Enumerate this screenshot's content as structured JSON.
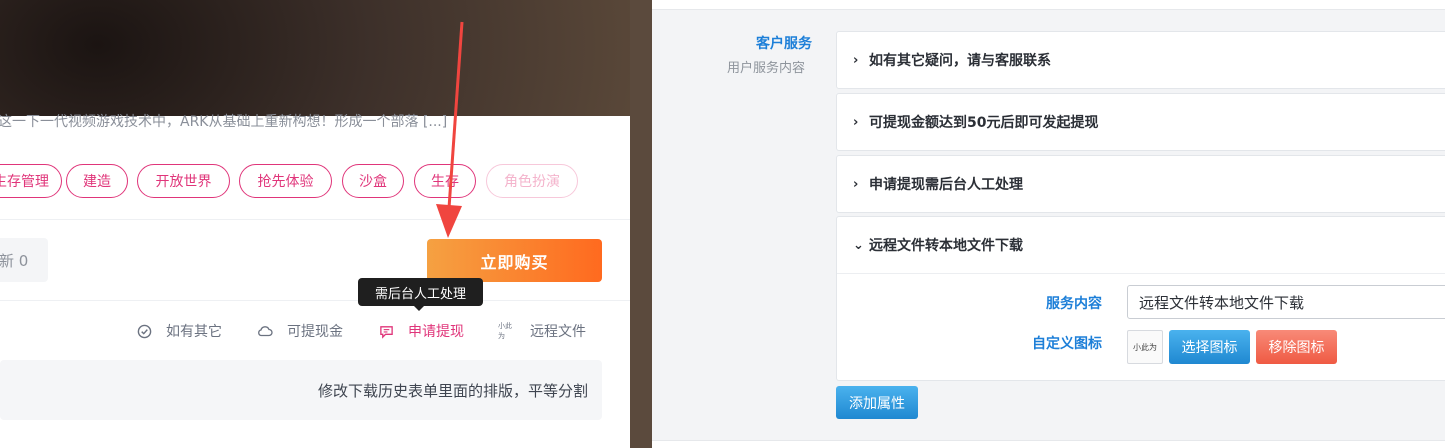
{
  "left": {
    "excerpt": "这一下一代视频游戏技术中，ARK从基础上重新构想！形成一个部落 [...]",
    "tags": [
      {
        "label": "生存管理",
        "faded": false
      },
      {
        "label": "建造",
        "faded": false
      },
      {
        "label": "开放世界",
        "faded": false
      },
      {
        "label": "抢先体验",
        "faded": false
      },
      {
        "label": "沙盒",
        "faded": false
      },
      {
        "label": "生存",
        "faded": false
      },
      {
        "label": "角色扮演",
        "faded": true
      }
    ],
    "update_label": "新 0",
    "buy_button": "立即购买",
    "tooltip": "需后台人工处理",
    "service_tabs": [
      {
        "label": "如有其它",
        "icon": "check-circle-icon"
      },
      {
        "label": "可提现金",
        "icon": "cloud-icon"
      },
      {
        "label": "申请提现",
        "icon": "chat-icon"
      },
      {
        "label": "远程文件",
        "icon": "custom-logo-icon",
        "icon_text": "小此为"
      }
    ],
    "active_tab": 2,
    "content_text": "修改下载历史表单里面的排版，平等分割"
  },
  "right": {
    "section_title": "客户服务",
    "section_sub": "用户服务内容",
    "accordion": [
      {
        "title": "如有其它疑问，请与客服联系",
        "expanded": false
      },
      {
        "title": "可提现金额达到50元后即可发起提现",
        "expanded": false
      },
      {
        "title": "申请提现需后台人工处理",
        "expanded": false
      },
      {
        "title": "远程文件转本地文件下载",
        "expanded": true
      }
    ],
    "field_content_label": "服务内容",
    "field_content_value": "远程文件转本地文件下载",
    "field_icon_label": "自定义图标",
    "icon_preview_text": "小此为",
    "choose_icon": "选择图标",
    "remove_icon": "移除图标",
    "add_attr": "添加属性"
  },
  "colors": {
    "accent_pink": "#e0357a",
    "buy_orange": "#ff6a1f",
    "link_blue": "#1d7fd8",
    "arrow_red": "#f0453f"
  }
}
